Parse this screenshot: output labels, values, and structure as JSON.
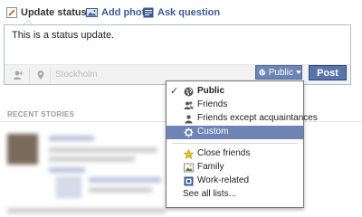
{
  "tabs": [
    {
      "label": "Update status",
      "icon": "pencil-icon"
    },
    {
      "label": "Add photo",
      "icon": "photo-icon"
    },
    {
      "label": "Ask question",
      "icon": "question-icon"
    }
  ],
  "composer": {
    "text": "This is a status update.",
    "location_placeholder": "Stockholm",
    "privacy_label": "Public",
    "post_label": "Post"
  },
  "feed": {
    "section_title": "RECENT STORIES"
  },
  "privacy_menu": {
    "items": [
      {
        "label": "Public",
        "icon": "globe-icon",
        "checked": true
      },
      {
        "label": "Friends",
        "icon": "friends-icon"
      },
      {
        "label": "Friends except acquaintances",
        "icon": "friend-icon"
      },
      {
        "label": "Custom",
        "icon": "gear-icon",
        "selected": true
      },
      {
        "label": "Close friends",
        "icon": "star-icon"
      },
      {
        "label": "Family",
        "icon": "family-icon"
      },
      {
        "label": "Work-related",
        "icon": "work-icon"
      },
      {
        "label": "See all lists..."
      }
    ],
    "check_glyph": "✓"
  },
  "colors": {
    "brand": "#3b5998",
    "button": "#5b74a8",
    "menu_highlight": "#6d84b4"
  }
}
